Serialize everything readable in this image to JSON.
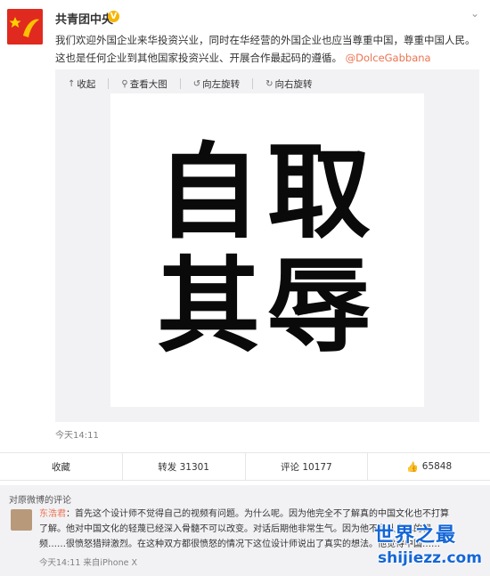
{
  "post": {
    "author": "共青团中央",
    "verified_badge": "V",
    "text_part1": "我们欢迎外国企业来华投资兴业，同时在华经营的外国企业也应当尊重中国，尊重中国人民。这也是任何企业到其他国家投资兴业、开展合作最起码的遵循。",
    "mention": "@DolceGabbana",
    "menu_icon": "chevron-down-icon",
    "timestamp": "今天14:11"
  },
  "media_toolbar": {
    "collapse": "收起",
    "view_large": "查看大图",
    "rotate_left": "向左旋转",
    "rotate_right": "向右旋转"
  },
  "image_text": {
    "line1": "自取",
    "line2": "其辱"
  },
  "actions": {
    "favorite": "收藏",
    "repost": "转发 31301",
    "comment": "评论 10177",
    "like": "65848"
  },
  "comments": {
    "title": "对原微博的评论",
    "items": [
      {
        "name": "东浩君",
        "text": "：首先这个设计师不觉得自己的视频有问题。为什么呢。因为他完全不了解真的中国文化也不打算了解。他对中国文化的轻蔑已经深入骨髓不可以改变。对话后期他非常生气。因为他不承认自己的视频……很愤怒猎辩激烈。在这种双方都很愤怒的情况下这位设计师说出了真实的想法。他觉得中国……",
        "meta": "今天14:11 来自iPhone X"
      }
    ]
  },
  "watermark": {
    "main": "世界之最",
    "sub": "shijiezz.com"
  },
  "colors": {
    "accent": "#eb7350",
    "avatar_red": "#e02a1f",
    "watermark_blue": "#1466d6"
  }
}
